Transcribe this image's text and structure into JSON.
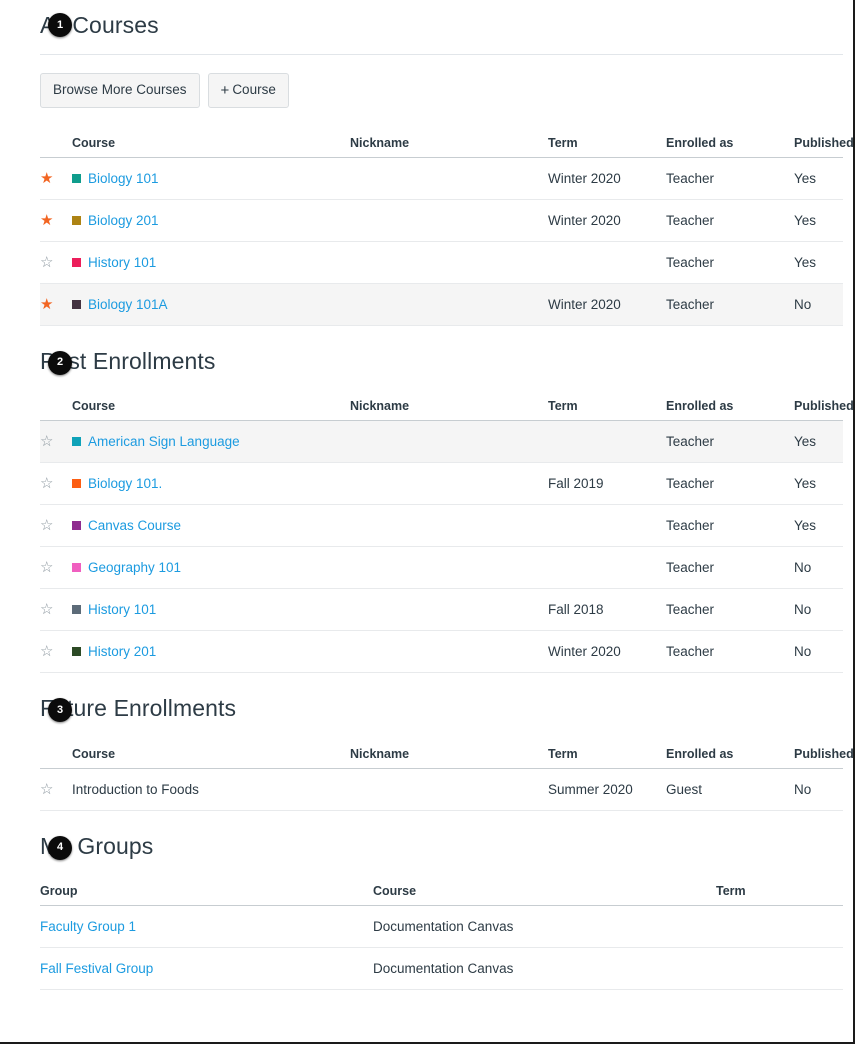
{
  "colors": {
    "link": "#1C9BE0",
    "star_on": "#F26522",
    "star_off": "#8B969E",
    "unpublished_highlight": "#F26522",
    "text": "#2D3B45"
  },
  "icons": {
    "star_filled": "★",
    "star_outline": "☆",
    "plus": "+"
  },
  "callouts": [
    {
      "number": "1"
    },
    {
      "number": "2"
    },
    {
      "number": "3"
    },
    {
      "number": "4"
    }
  ],
  "sections": {
    "all_courses": {
      "title": "All Courses",
      "buttons": {
        "browse": "Browse More Courses",
        "add_course": "Course"
      },
      "columns": [
        "Course",
        "Nickname",
        "Term",
        "Enrolled as",
        "Published"
      ],
      "rows": [
        {
          "star": "filled",
          "swatch": "#0F9D8C",
          "course": "Biology 101",
          "is_link": true,
          "nickname": "",
          "term": "Winter 2020",
          "role": "Teacher",
          "published": "Yes",
          "published_highlight": false,
          "alt": false
        },
        {
          "star": "filled",
          "swatch": "#AD8313",
          "course": "Biology 201",
          "is_link": true,
          "nickname": "",
          "term": "Winter 2020",
          "role": "Teacher",
          "published": "Yes",
          "published_highlight": false,
          "alt": false
        },
        {
          "star": "empty",
          "swatch": "#EC1E5B",
          "course": "History 101",
          "is_link": true,
          "nickname": "",
          "term": "",
          "role": "Teacher",
          "published": "Yes",
          "published_highlight": false,
          "alt": false
        },
        {
          "star": "filled",
          "swatch": "#443341",
          "course": "Biology 101A",
          "is_link": true,
          "nickname": "",
          "term": "Winter 2020",
          "role": "Teacher",
          "published": "No",
          "published_highlight": true,
          "alt": true
        }
      ]
    },
    "past_enrollments": {
      "title": "Past Enrollments",
      "columns": [
        "Course",
        "Nickname",
        "Term",
        "Enrolled as",
        "Published"
      ],
      "rows": [
        {
          "star": "empty",
          "swatch": "#0FA2B8",
          "course": "American Sign Language",
          "is_link": true,
          "nickname": "",
          "term": "",
          "role": "Teacher",
          "published": "Yes",
          "published_highlight": false,
          "alt": true
        },
        {
          "star": "empty",
          "swatch": "#FC5E13",
          "course": "Biology 101.",
          "is_link": true,
          "nickname": "",
          "term": "Fall 2019",
          "role": "Teacher",
          "published": "Yes",
          "published_highlight": false,
          "alt": false
        },
        {
          "star": "empty",
          "swatch": "#8F2C8F",
          "course": "Canvas Course",
          "is_link": true,
          "nickname": "",
          "term": "",
          "role": "Teacher",
          "published": "Yes",
          "published_highlight": false,
          "alt": false
        },
        {
          "star": "empty",
          "swatch": "#F05FC0",
          "course": "Geography 101",
          "is_link": true,
          "nickname": "",
          "term": "",
          "role": "Teacher",
          "published": "No",
          "published_highlight": false,
          "alt": false
        },
        {
          "star": "empty",
          "swatch": "#5C6B78",
          "course": "History 101",
          "is_link": true,
          "nickname": "",
          "term": "Fall 2018",
          "role": "Teacher",
          "published": "No",
          "published_highlight": false,
          "alt": false
        },
        {
          "star": "empty",
          "swatch": "#2C4A25",
          "course": "History 201",
          "is_link": true,
          "nickname": "",
          "term": "Winter 2020",
          "role": "Teacher",
          "published": "No",
          "published_highlight": false,
          "alt": false
        }
      ]
    },
    "future_enrollments": {
      "title": "Future Enrollments",
      "columns": [
        "Course",
        "Nickname",
        "Term",
        "Enrolled as",
        "Published"
      ],
      "rows": [
        {
          "star": "empty",
          "swatch": "",
          "course": "Introduction to Foods",
          "is_link": false,
          "nickname": "",
          "term": "Summer 2020",
          "role": "Guest",
          "published": "No",
          "published_highlight": false,
          "alt": false
        }
      ]
    },
    "my_groups": {
      "title": "My Groups",
      "columns": [
        "Group",
        "Course",
        "Term"
      ],
      "rows": [
        {
          "group": "Faculty Group 1",
          "course": "Documentation Canvas",
          "term": ""
        },
        {
          "group": "Fall Festival Group",
          "course": "Documentation Canvas",
          "term": ""
        }
      ]
    }
  }
}
